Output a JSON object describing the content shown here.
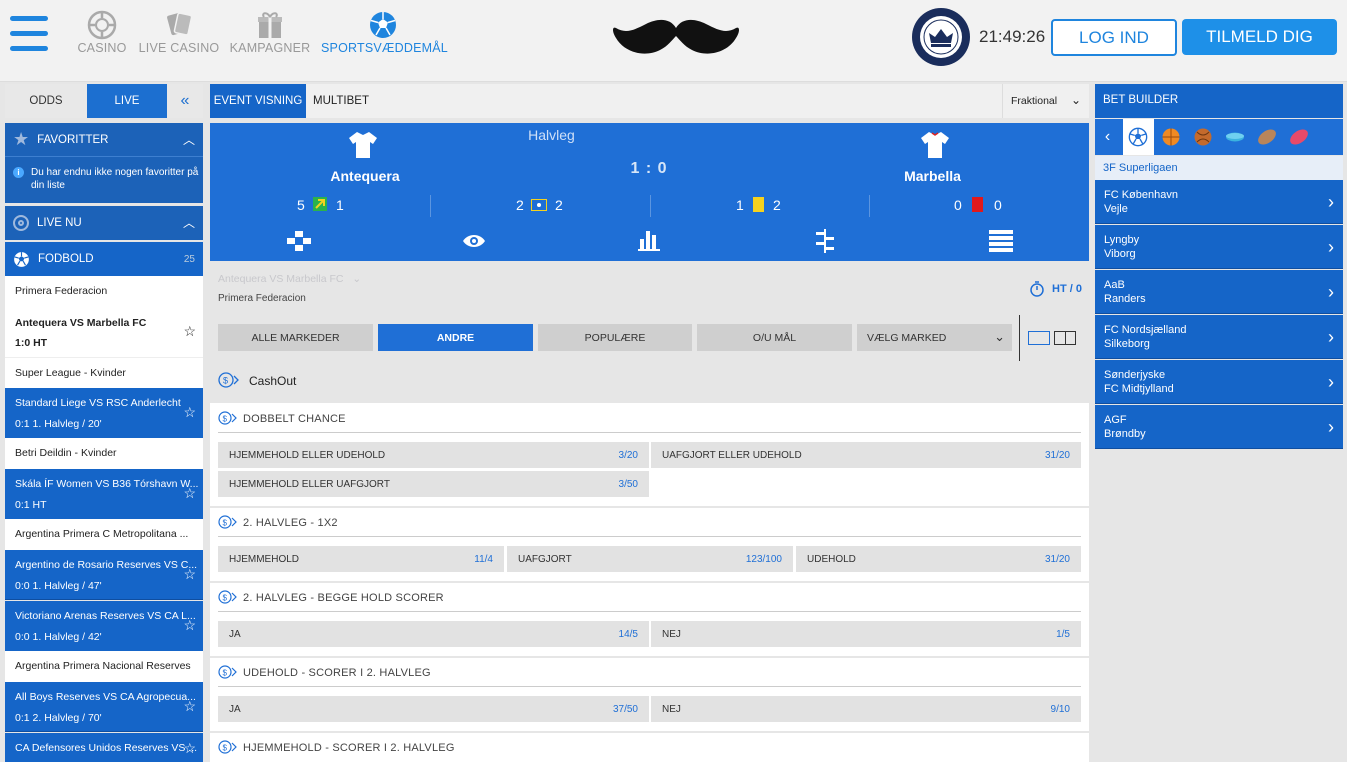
{
  "header": {
    "nav": [
      {
        "label": "CASINO",
        "icon": "casino-chip-icon"
      },
      {
        "label": "LIVE CASINO",
        "icon": "playing-cards-icon"
      },
      {
        "label": "KAMPAGNER",
        "icon": "gift-icon"
      },
      {
        "label": "SPORTSVÆDDEMÅL",
        "icon": "soccer-ball-icon"
      }
    ],
    "logo": "mustache-logo",
    "clock": "21:49:26",
    "login_label": "LOG IND",
    "signup_label": "TILMELD DIG"
  },
  "sidebar": {
    "tabs": [
      {
        "label": "ODDS"
      },
      {
        "label": "LIVE"
      }
    ],
    "favorites": {
      "title": "FAVORITTER",
      "empty_text_1": "Du har endnu ikke nogen favoritter på",
      "empty_text_2": "din liste"
    },
    "live_now": "LIVE NU",
    "football": {
      "title": "FODBOLD",
      "count": "25"
    },
    "rows": [
      {
        "type": "league",
        "text": "Primera Federacion"
      },
      {
        "type": "match-white",
        "line1": "Antequera VS Marbella FC",
        "line2": "1:0 HT"
      },
      {
        "type": "league",
        "text": "Super League - Kvinder"
      },
      {
        "type": "match",
        "line1": "Standard Liege VS RSC Anderlecht",
        "line2": "0:1 1. Halvleg / 20'"
      },
      {
        "type": "league",
        "text": "Betri Deildin - Kvinder"
      },
      {
        "type": "match",
        "line1": "Skála ÍF Women VS B36 Tórshavn W...",
        "line2": "0:1 HT"
      },
      {
        "type": "league",
        "text": "Argentina Primera C Metropolitana ..."
      },
      {
        "type": "match",
        "line1": "Argentino de Rosario Reserves VS C...",
        "line2": "0:0 1. Halvleg / 47'"
      },
      {
        "type": "match",
        "line1": "Victoriano Arenas Reserves VS CA L...",
        "line2": "0:0 1. Halvleg / 42'"
      },
      {
        "type": "league",
        "text": "Argentina Primera Nacional Reserves"
      },
      {
        "type": "match",
        "line1": "All Boys Reserves VS CA Agropecua...",
        "line2": "0:1 2. Halvleg / 70'"
      },
      {
        "type": "match",
        "line1": "CA Defensores Unidos Reserves VS ...",
        "line2": ""
      }
    ]
  },
  "center": {
    "tabs": [
      {
        "label": "EVENT VISNING"
      },
      {
        "label": "MULTIBET"
      }
    ],
    "odds_format": "Fraktional",
    "scoreboard": {
      "period": "Halvleg",
      "home": "Antequera",
      "away": "Marbella",
      "score": "1 : 0",
      "stats": [
        {
          "left": "5",
          "right": "1",
          "icon": "corner-icon"
        },
        {
          "left": "2",
          "right": "2",
          "icon": "penalty-icon"
        },
        {
          "left": "1",
          "right": "2",
          "icon": "yellow-card-icon"
        },
        {
          "left": "0",
          "right": "0",
          "icon": "red-card-icon"
        }
      ]
    },
    "event_title": "Antequera VS Marbella FC",
    "league": "Primera Federacion",
    "status": "HT / 0",
    "market_tabs": [
      "ALLE MARKEDER",
      "ANDRE",
      "POPULÆRE",
      "O/U MÅL",
      "VÆLG MARKED"
    ],
    "cashout": "CashOut",
    "sections": [
      {
        "title": "DOBBELT CHANCE",
        "odds": [
          {
            "label": "HJEMMEHOLD ELLER UDEHOLD",
            "value": "3/20"
          },
          {
            "label": "UAFGJORT ELLER UDEHOLD",
            "value": "31/20"
          },
          {
            "label": "HJEMMEHOLD ELLER UAFGJORT",
            "value": "3/50"
          }
        ]
      },
      {
        "title": "2. HALVLEG - 1X2",
        "odds": [
          {
            "label": "HJEMMEHOLD",
            "value": "11/4"
          },
          {
            "label": "UAFGJORT",
            "value": "123/100"
          },
          {
            "label": "UDEHOLD",
            "value": "31/20"
          }
        ]
      },
      {
        "title": "2. HALVLEG - BEGGE HOLD SCORER",
        "odds": [
          {
            "label": "JA",
            "value": "14/5"
          },
          {
            "label": "NEJ",
            "value": "1/5"
          }
        ]
      },
      {
        "title": "UDEHOLD - SCORER I 2. HALVLEG",
        "odds": [
          {
            "label": "JA",
            "value": "37/50"
          },
          {
            "label": "NEJ",
            "value": "9/10"
          }
        ]
      },
      {
        "title": "HJEMMEHOLD - SCORER I 2. HALVLEG",
        "odds": []
      }
    ]
  },
  "right": {
    "title": "BET BUILDER",
    "sports": [
      "soccer-icon",
      "basketball-icon",
      "handball-icon",
      "ice-hockey-icon",
      "rugby-icon",
      "american-football-icon"
    ],
    "league": "3F Superligaen",
    "matches": [
      {
        "home": "FC København",
        "away": "Vejle"
      },
      {
        "home": "Lyngby",
        "away": "Viborg"
      },
      {
        "home": "AaB",
        "away": "Randers"
      },
      {
        "home": "FC Nordsjælland",
        "away": "Silkeborg"
      },
      {
        "home": "Sønderjyske",
        "away": "FC Midtjylland"
      },
      {
        "home": "AGF",
        "away": "Brøndby"
      }
    ]
  },
  "colors": {
    "accent": "#1f85de",
    "blue": "#1565c8",
    "scoreboard": "#1f6fd6",
    "yellow_card": "#f5d21f",
    "red_card": "#e0191c"
  }
}
